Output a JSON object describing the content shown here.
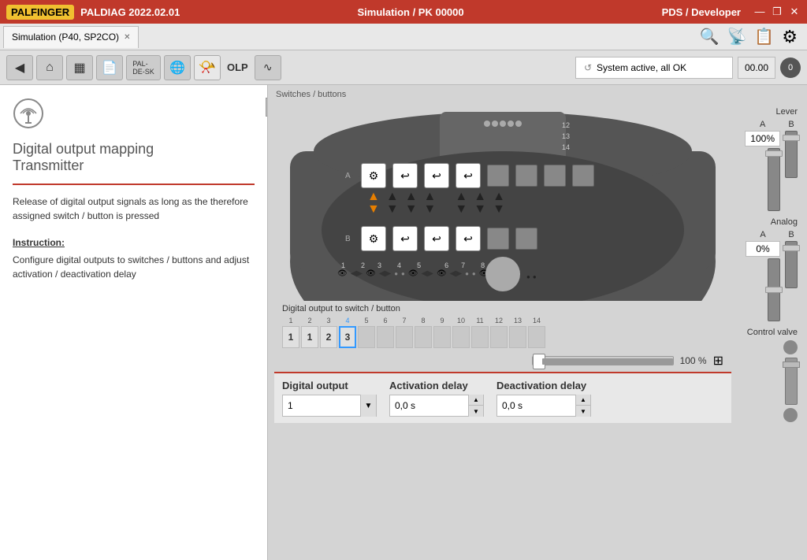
{
  "titlebar": {
    "logo": "PALFINGER",
    "app": "PALDIAG 2022.02.01",
    "simulation": "Simulation / PK 00000",
    "pds": "PDS / Developer",
    "minimize": "—",
    "restore": "❐",
    "close": "✕"
  },
  "tabs": [
    {
      "label": "Simulation (P40, SP2CO)",
      "active": true
    }
  ],
  "toolbar": {
    "back_label": "◀",
    "home_label": "⌂",
    "monitor_label": "▦",
    "save_label": "💾",
    "pal_desk_label": "PAL-DE-SK",
    "globe_label": "🌐",
    "horn_label": "📯",
    "olp_label": "OLP",
    "wave_label": "〜",
    "status_text": "System active, all OK",
    "status_time": "00.00",
    "alert_num": "0"
  },
  "header_icons": {
    "search_zoom": "🔍",
    "wifi": "📡",
    "clipboard": "📋",
    "settings": "⚙"
  },
  "left_panel": {
    "icon": "📡",
    "title": "Digital output mapping\nTransmitter",
    "description": "Release of digital output signals as long as the therefore assigned switch / button is pressed",
    "instruction_label": "Instruction:",
    "instruction_body": "Configure digital outputs to switches / buttons and adjust activation / deactivation delay",
    "collapse_icon": "❯"
  },
  "switches_label": "Switches / buttons",
  "mapping": {
    "label": "Digital output to switch / button",
    "numbers": [
      "1",
      "2",
      "3",
      "4",
      "5",
      "6",
      "7",
      "8",
      "9",
      "10",
      "11",
      "12",
      "13",
      "14"
    ],
    "cells": [
      {
        "value": "1",
        "highlight": false
      },
      {
        "value": "1",
        "highlight": false
      },
      {
        "value": "2",
        "highlight": false
      },
      {
        "value": "3",
        "highlight": true
      },
      {
        "value": "",
        "highlight": false,
        "gray": true
      },
      {
        "value": "",
        "highlight": false,
        "gray": true
      },
      {
        "value": "",
        "highlight": false,
        "gray": true
      },
      {
        "value": "",
        "highlight": false,
        "gray": true
      },
      {
        "value": "",
        "highlight": false,
        "gray": true
      },
      {
        "value": "",
        "highlight": false,
        "gray": true
      },
      {
        "value": "",
        "highlight": false,
        "gray": true
      },
      {
        "value": "",
        "highlight": false,
        "gray": true
      },
      {
        "value": "",
        "highlight": false,
        "gray": true
      },
      {
        "value": "",
        "highlight": false,
        "gray": true
      }
    ]
  },
  "slider": {
    "value": "100 %",
    "position": 100
  },
  "config": {
    "digital_output_label": "Digital output",
    "digital_output_value": "1",
    "digital_output_arrow": "▼",
    "activation_delay_label": "Activation delay",
    "activation_delay_value": "0,0 s",
    "deactivation_delay_label": "Deactivation delay",
    "deactivation_delay_value": "0,0 s"
  },
  "levers": {
    "lever_label": "Lever",
    "a_label": "A",
    "a_value": "100%",
    "b_label": "B",
    "analog_label": "Analog",
    "analog_a_label": "A",
    "analog_a_value": "0%",
    "analog_b_label": "B",
    "control_valve_label": "Control valve"
  }
}
